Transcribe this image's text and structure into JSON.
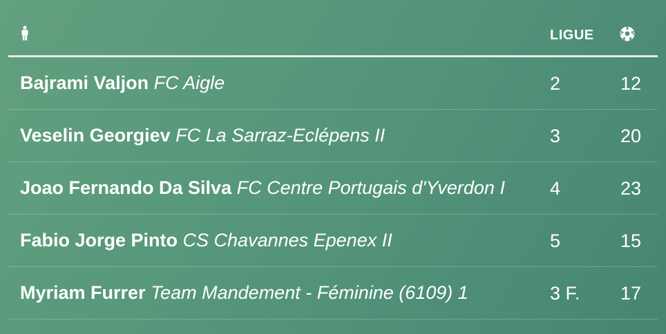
{
  "header": {
    "player_icon": "person-icon",
    "league_label": "LIGUE",
    "goals_icon": "soccer-ball-icon"
  },
  "rows": [
    {
      "name": "Bajrami Valjon",
      "club": "FC Aigle",
      "league": "2",
      "goals": "12"
    },
    {
      "name": "Veselin Georgiev",
      "club": "FC La Sarraz-Eclépens II",
      "league": "3",
      "goals": "20"
    },
    {
      "name": "Joao Fernando Da Silva",
      "club": "FC Centre Portugais d'Yverdon I",
      "league": "4",
      "goals": "23"
    },
    {
      "name": "Fabio Jorge Pinto",
      "club": "CS Chavannes Epenex II",
      "league": "5",
      "goals": "15"
    },
    {
      "name": "Myriam Furrer",
      "club": "Team Mandement - Féminine (6109) 1",
      "league": "3 F.",
      "goals": "17"
    }
  ],
  "colors": {
    "background_start": "#62a07e",
    "background_end": "#478572",
    "text": "#ffffff"
  }
}
